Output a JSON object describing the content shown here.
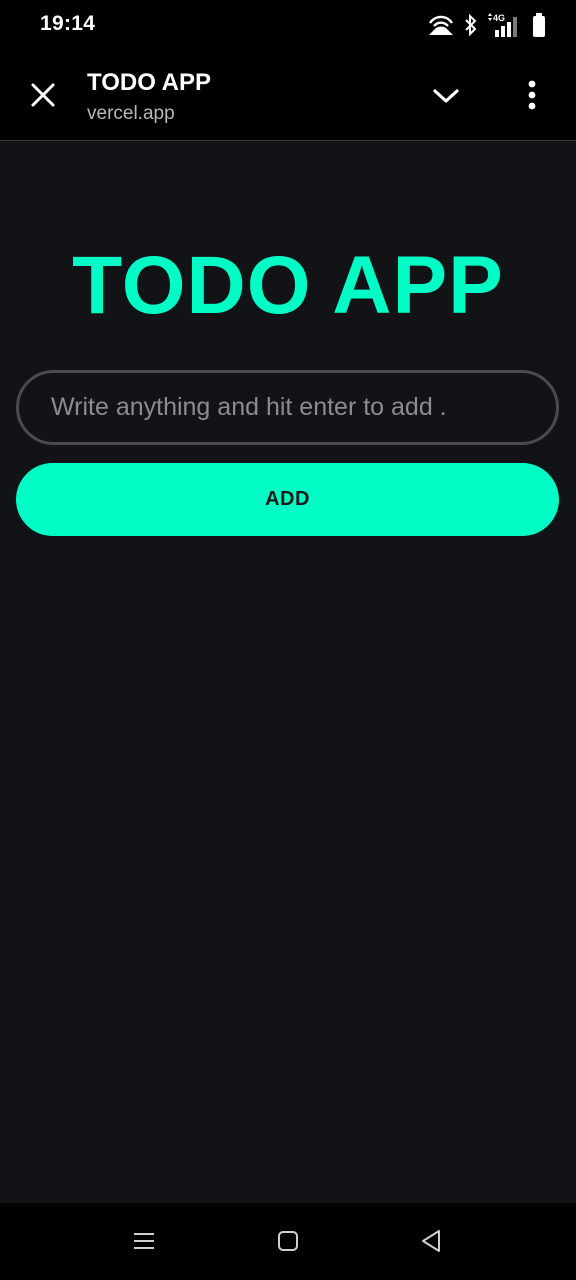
{
  "status_bar": {
    "time": "19:14",
    "icons": [
      "hotspot-icon",
      "bluetooth-icon",
      "signal-4g-icon",
      "battery-icon"
    ],
    "network_label": "4G"
  },
  "tab_header": {
    "title": "TODO APP",
    "url": "vercel.app",
    "icons": [
      "close-icon",
      "chevron-down-icon",
      "more-vert-icon"
    ]
  },
  "app": {
    "heading": "TODO APP",
    "input_placeholder": "Write anything and hit enter to add .",
    "input_value": "",
    "add_label": "ADD"
  },
  "nav_bar": {
    "icons": [
      "recents-icon",
      "home-icon",
      "back-icon"
    ]
  },
  "colors": {
    "accent": "#00fdc5",
    "background": "#121317",
    "bars": "#000000",
    "input_border": "#4a4b52"
  }
}
